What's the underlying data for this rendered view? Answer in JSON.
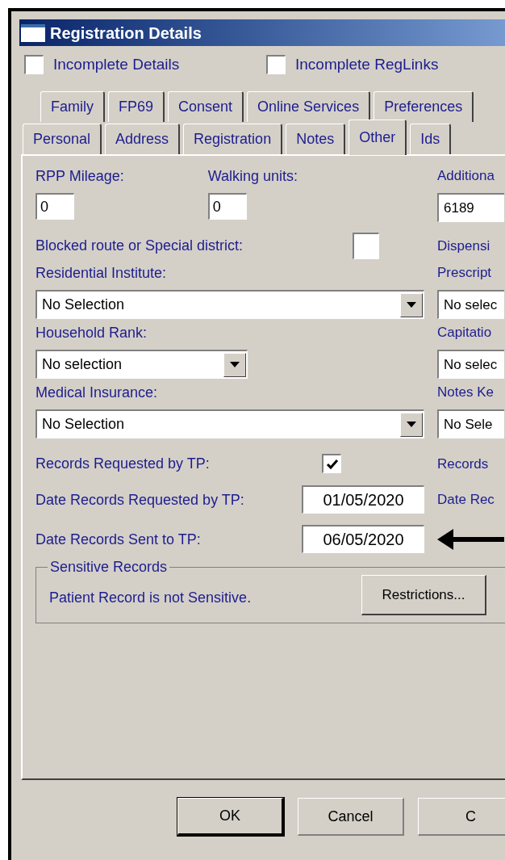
{
  "window": {
    "title": "Registration Details"
  },
  "flags": [
    {
      "label": "Incomplete Details",
      "checked": false
    },
    {
      "label": "Incomplete RegLinks",
      "checked": false
    }
  ],
  "tab_rows": [
    [
      {
        "label": "Family",
        "selected": false
      },
      {
        "label": "FP69",
        "selected": false
      },
      {
        "label": "Consent",
        "selected": false
      },
      {
        "label": "Online Services",
        "selected": false
      },
      {
        "label": "Preferences",
        "selected": false
      }
    ],
    [
      {
        "label": "Personal",
        "selected": false
      },
      {
        "label": "Address",
        "selected": false
      },
      {
        "label": "Registration",
        "selected": false
      },
      {
        "label": "Notes",
        "selected": false
      },
      {
        "label": "Other",
        "selected": true
      },
      {
        "label": "Ids",
        "selected": false
      }
    ]
  ],
  "other_tab": {
    "rpp_mileage": {
      "label": "RPP Mileage:",
      "value": "0"
    },
    "walking_units": {
      "label": "Walking units:",
      "value": "0"
    },
    "column_2_field_1": {
      "label": "Additiona",
      "value": "6189"
    },
    "blocked_route": {
      "label": "Blocked route or Special district:",
      "checked": false
    },
    "column_2_label_2": {
      "label": "Dispensi"
    },
    "residential_institute": {
      "label": "Residential Institute:",
      "value": "No Selection"
    },
    "column_2_field_3": {
      "label": "Prescript",
      "value": "No selec"
    },
    "household_rank": {
      "label": "Household Rank:",
      "value": "No selection"
    },
    "column_2_field_4": {
      "label": "Capitatio",
      "value": "No selec"
    },
    "medical_insurance": {
      "label": "Medical Insurance:",
      "value": "No Selection"
    },
    "column_2_field_5": {
      "label": "Notes Ke",
      "value": "No Sele"
    },
    "records_requested": {
      "label": "Records Requested by TP:",
      "checked": true
    },
    "column_2_label_6": {
      "label": "Records"
    },
    "date_requested": {
      "label": "Date Records Requested by TP:",
      "value": "01/05/2020"
    },
    "column_2_label_7": {
      "label": "Date Rec"
    },
    "date_sent": {
      "label": "Date Records Sent to TP:",
      "value": "06/05/2020"
    },
    "sensitive_records": {
      "title": "Sensitive Records",
      "text": "Patient Record is not Sensitive.",
      "button": "Restrictions..."
    }
  },
  "buttons": [
    {
      "label": "OK",
      "default": true
    },
    {
      "label": "Cancel",
      "default": false
    },
    {
      "label": "C",
      "default": false
    }
  ]
}
